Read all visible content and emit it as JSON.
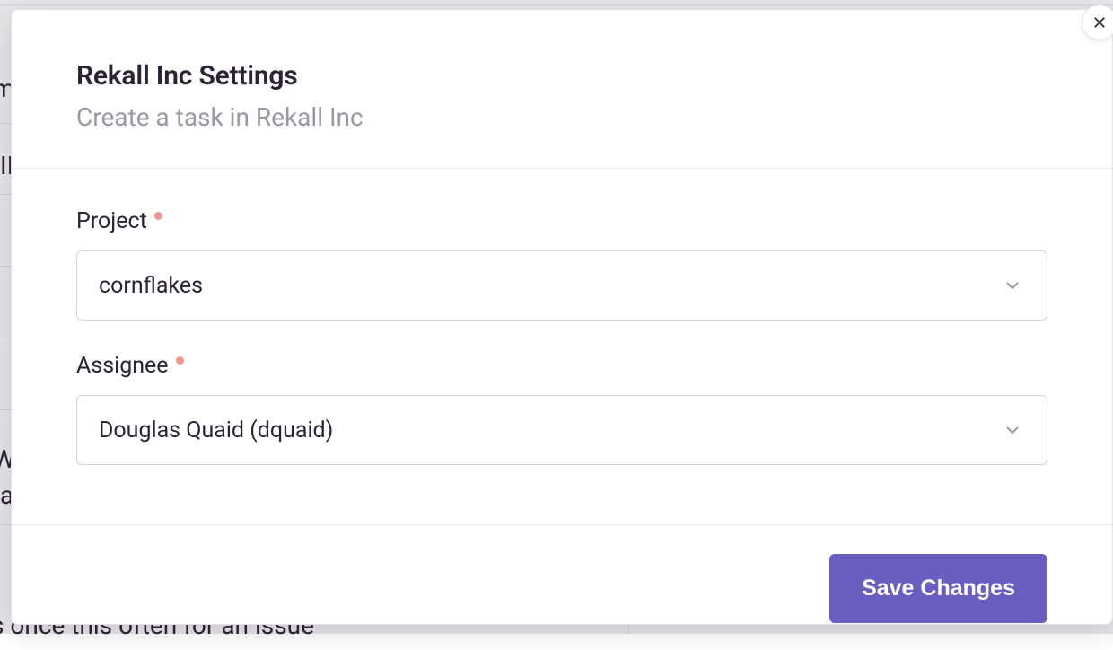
{
  "modal": {
    "title": "Rekall Inc Settings",
    "subtitle": "Create a task in Rekall Inc",
    "fields": {
      "project": {
        "label": "Project",
        "value": "cornflakes"
      },
      "assignee": {
        "label": "Assignee",
        "value": "Douglas Quaid (dquaid)"
      }
    },
    "save_label": "Save Changes"
  },
  "background": {
    "frag1": "m",
    "frag2": "II",
    "frag3": "W",
    "frag4": "a",
    "frag5": "s once this often for an issue"
  }
}
